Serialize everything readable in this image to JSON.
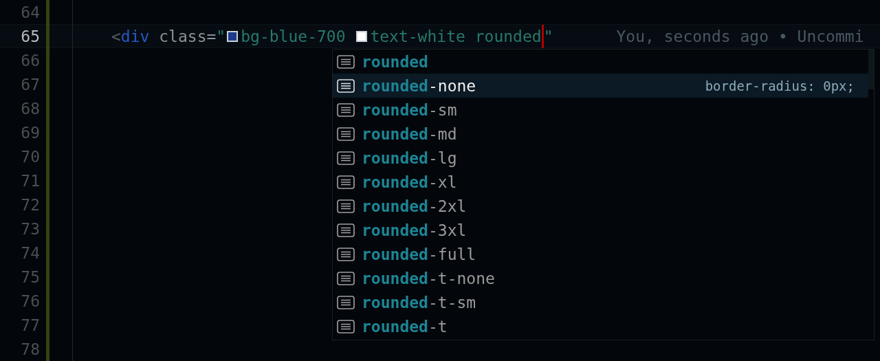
{
  "editor": {
    "lines": [
      {
        "number": "64",
        "current": false
      },
      {
        "number": "65",
        "current": true,
        "tokens": [
          {
            "kind": "punct",
            "text": "<"
          },
          {
            "kind": "tag",
            "text": "div"
          },
          {
            "kind": "attr",
            "text": " class="
          },
          {
            "kind": "string",
            "text": "\""
          },
          {
            "kind": "swatch",
            "color": "#1e3a8a"
          },
          {
            "kind": "string",
            "text": "bg-blue-700 "
          },
          {
            "kind": "swatch",
            "color": "#ffffff"
          },
          {
            "kind": "string",
            "text": "text-white rounded"
          },
          {
            "kind": "cursor"
          },
          {
            "kind": "string",
            "text": "\""
          }
        ],
        "blame": "You, seconds ago • Uncommi"
      },
      {
        "number": "66",
        "current": false
      },
      {
        "number": "67",
        "current": false
      },
      {
        "number": "68",
        "current": false
      },
      {
        "number": "69",
        "current": false
      },
      {
        "number": "70",
        "current": false
      },
      {
        "number": "71",
        "current": false
      },
      {
        "number": "72",
        "current": false
      },
      {
        "number": "73",
        "current": false
      },
      {
        "number": "74",
        "current": false
      },
      {
        "number": "75",
        "current": false
      },
      {
        "number": "76",
        "current": false
      },
      {
        "number": "77",
        "current": false
      },
      {
        "number": "78",
        "current": false
      }
    ]
  },
  "suggestions": [
    {
      "match": "rounded",
      "selected": false
    },
    {
      "match": "rounded",
      "rest": "-none",
      "selected": true,
      "detail": "border-radius: 0px;"
    },
    {
      "match": "rounded",
      "rest": "-sm",
      "selected": false
    },
    {
      "match": "rounded",
      "rest": "-md",
      "selected": false
    },
    {
      "match": "rounded",
      "rest": "-lg",
      "selected": false
    },
    {
      "match": "rounded",
      "rest": "-xl",
      "selected": false
    },
    {
      "match": "rounded",
      "rest": "-2xl",
      "selected": false
    },
    {
      "match": "rounded",
      "rest": "-3xl",
      "selected": false
    },
    {
      "match": "rounded",
      "rest": "-full",
      "selected": false
    },
    {
      "match": "rounded",
      "rest": "-t-none",
      "selected": false
    },
    {
      "match": "rounded",
      "rest": "-t-sm",
      "selected": false
    },
    {
      "match": "rounded",
      "rest": "-t",
      "selected": false
    }
  ]
}
